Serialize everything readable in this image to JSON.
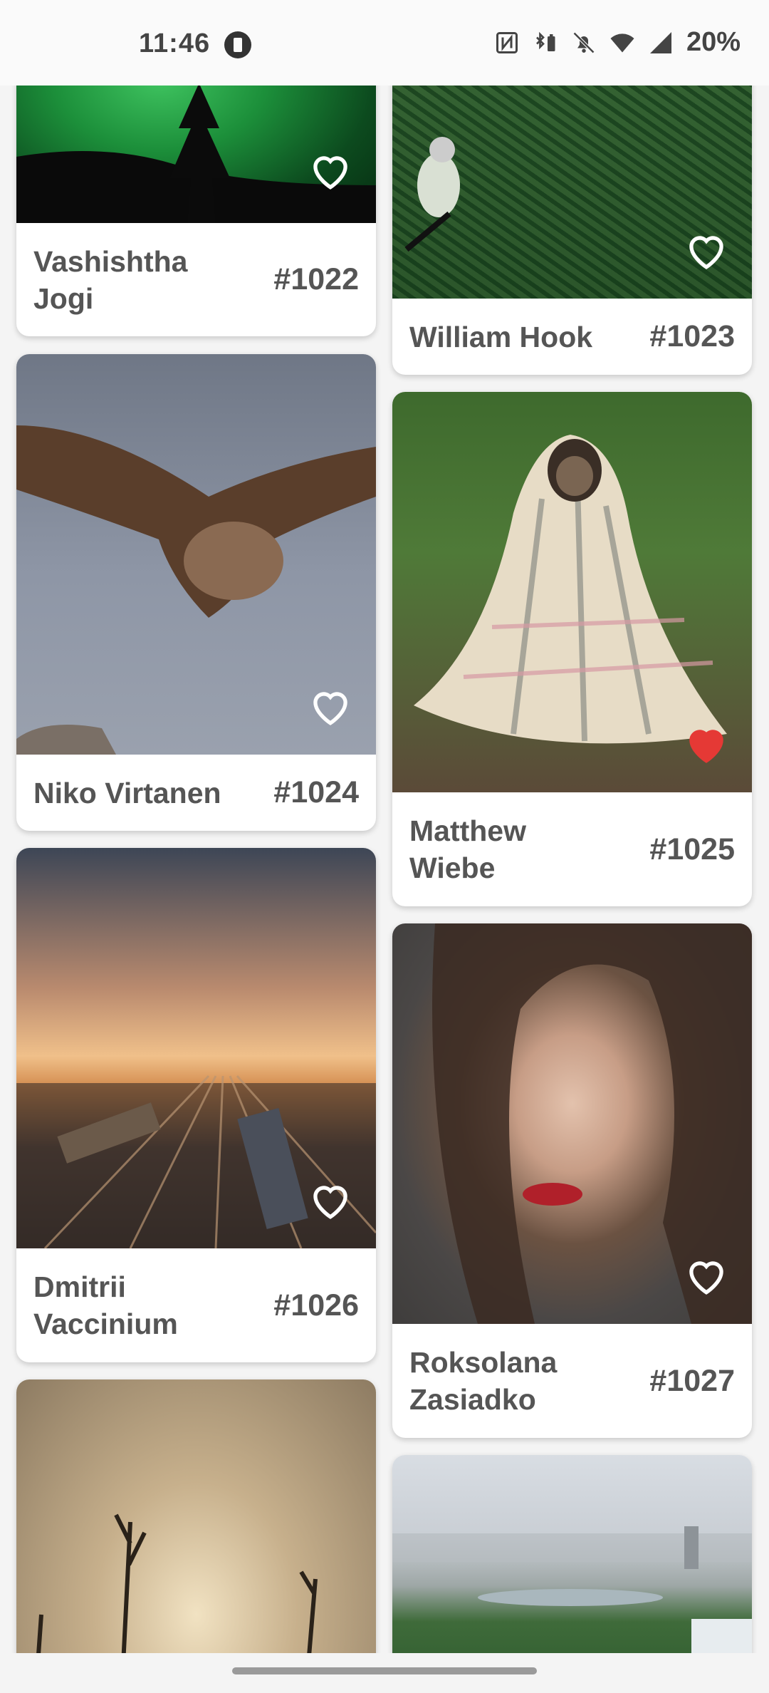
{
  "status_bar": {
    "time": "11:46",
    "battery": "20%",
    "icons": [
      "nfc-icon",
      "bluetooth-battery-icon",
      "bell-off-icon",
      "wifi-icon",
      "signal-icon"
    ]
  },
  "photos": [
    {
      "author": "Vashishtha Jogi",
      "number": "#1022",
      "liked": false
    },
    {
      "author": "William Hook",
      "number": "#1023",
      "liked": false
    },
    {
      "author": "Niko Virtanen",
      "number": "#1024",
      "liked": false
    },
    {
      "author": "Matthew Wiebe",
      "number": "#1025",
      "liked": true
    },
    {
      "author": "Dmitrii Vaccinium",
      "number": "#1026",
      "liked": false
    },
    {
      "author": "Roksolana Zasiadko",
      "number": "#1027",
      "liked": false
    }
  ],
  "colors": {
    "liked_heart": "#e53935",
    "heart_outline": "#ffffff",
    "caption_text": "#555555"
  }
}
